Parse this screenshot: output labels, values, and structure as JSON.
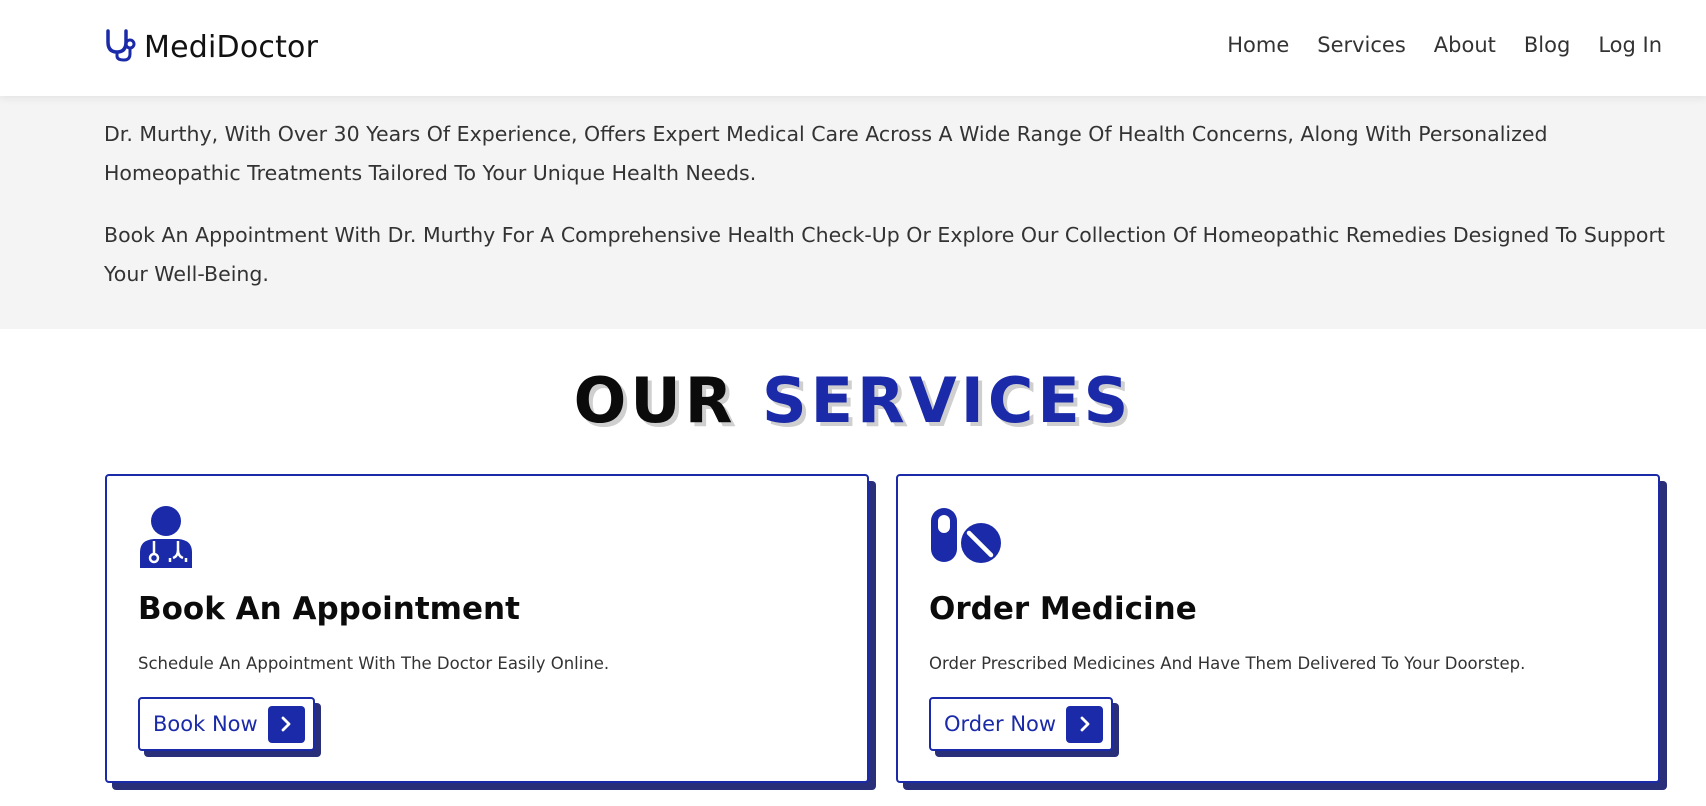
{
  "navbar": {
    "brand_icon": "stethoscope-icon",
    "brand_name": "MediDoctor",
    "links": [
      "Home",
      "Services",
      "About",
      "Blog",
      "Log In"
    ]
  },
  "intro": {
    "paragraph_1": "Dr. Murthy, With Over 30 Years Of Experience, Offers Expert Medical Care Across A Wide Range Of Health Concerns, Along With Personalized Homeopathic Treatments Tailored To Your Unique Health Needs.",
    "paragraph_2": "Book An Appointment With Dr. Murthy For A Comprehensive Health Check-Up Or Explore Our Collection Of Homeopathic Remedies Designed To Support Your Well-Being."
  },
  "services": {
    "title_part_1": "OUR",
    "title_part_2": "SERVICES",
    "cards": [
      {
        "icon": "doctor-icon",
        "title": "Book An Appointment",
        "description": "Schedule An Appointment With The Doctor Easily Online.",
        "button_label": "Book Now",
        "button_icon": "chevron-right-icon"
      },
      {
        "icon": "pills-icon",
        "title": "Order Medicine",
        "description": "Order Prescribed Medicines And Have Them Delivered To Your Doorstep.",
        "button_label": "Order Now",
        "button_icon": "chevron-right-icon"
      }
    ]
  },
  "colors": {
    "accent": "#1a2aa8",
    "shadow": "#2a2f7a",
    "intro_background": "#f4f4f4",
    "title_black": "#0b0b0b"
  }
}
